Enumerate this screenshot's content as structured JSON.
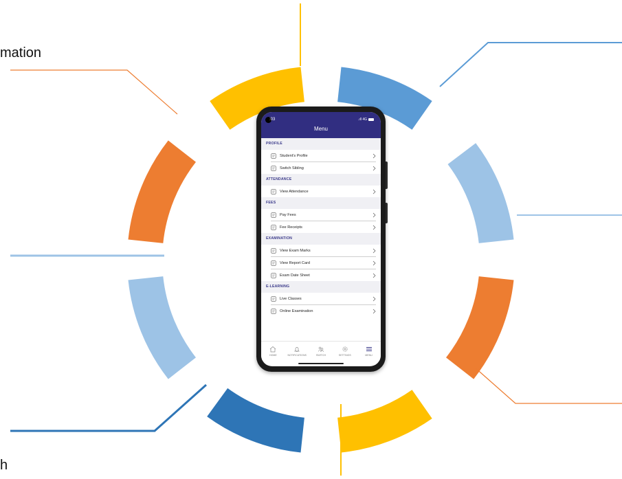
{
  "callouts": {
    "top_left": "mation",
    "bottom_left": "h"
  },
  "colors": {
    "orange": "#ED7D31",
    "gold": "#FFC000",
    "blue": "#5B9BD5",
    "light_blue": "#9DC3E6",
    "dark_blue": "#2E75B6",
    "app_header": "#312E81"
  },
  "phone": {
    "status_time": ":03",
    "status_right": ".ıll 4G",
    "title": "Menu",
    "sections": [
      {
        "label": "PROFILE",
        "items": [
          {
            "label": "Student's Profile",
            "icon": "profile-card-icon"
          },
          {
            "label": "Switch Sibling",
            "icon": "users-icon"
          }
        ]
      },
      {
        "label": "ATTENDANCE",
        "items": [
          {
            "label": "View Attendance",
            "icon": "attendance-icon"
          }
        ]
      },
      {
        "label": "FEES",
        "items": [
          {
            "label": "Pay Fees",
            "icon": "pay-fees-icon"
          },
          {
            "label": "Fee Receipts",
            "icon": "receipt-icon"
          }
        ]
      },
      {
        "label": "EXAMINATION",
        "items": [
          {
            "label": "View Exam Marks",
            "icon": "marks-icon"
          },
          {
            "label": "View Report Card",
            "icon": "report-card-icon"
          },
          {
            "label": "Exam Date Sheet",
            "icon": "calendar-icon"
          }
        ]
      },
      {
        "label": "E-LEARNING",
        "items": [
          {
            "label": "Live Classes",
            "icon": "live-classes-icon"
          },
          {
            "label": "Online Examination",
            "icon": "online-exam-icon"
          }
        ]
      }
    ],
    "nav": [
      {
        "label": "HOME",
        "icon": "home-icon"
      },
      {
        "label": "NOTIFICATIONS",
        "icon": "bell-icon"
      },
      {
        "label": "SWITCH",
        "icon": "switch-icon"
      },
      {
        "label": "SETTINGS",
        "icon": "gear-icon"
      },
      {
        "label": "MENU",
        "icon": "menu-icon"
      }
    ]
  }
}
